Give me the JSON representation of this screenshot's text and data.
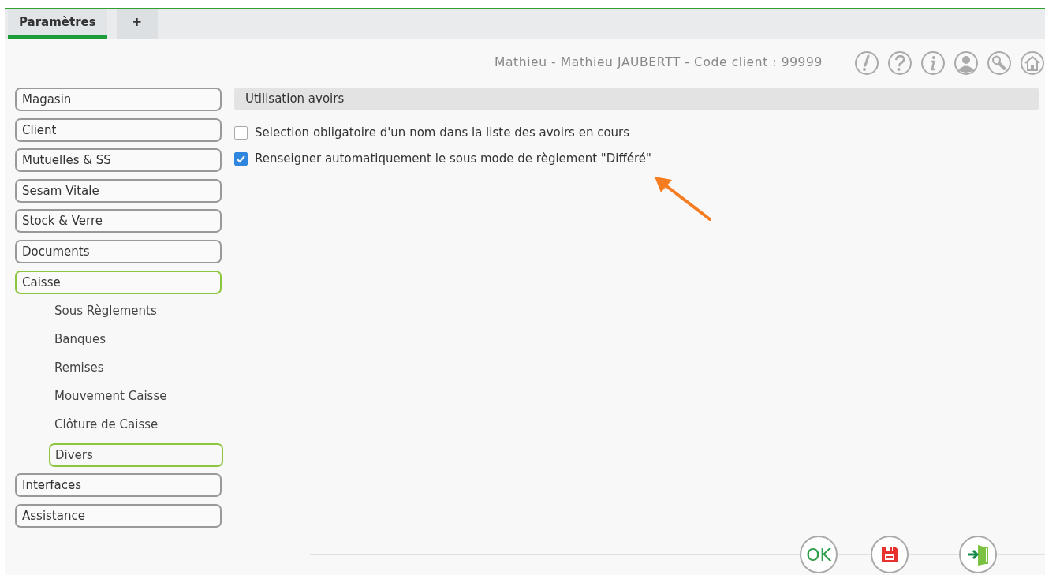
{
  "tabs": [
    {
      "label": "Paramètres",
      "selected": true
    },
    {
      "label": "+",
      "selected": false
    }
  ],
  "user_info": "Mathieu - Mathieu JAUBERTT - Code client : 99999",
  "sidebar": {
    "items": [
      {
        "label": "Magasin",
        "selected": false
      },
      {
        "label": "Client",
        "selected": false
      },
      {
        "label": "Mutuelles & SS",
        "selected": false
      },
      {
        "label": "Sesam Vitale",
        "selected": false
      },
      {
        "label": "Stock & Verre",
        "selected": false
      },
      {
        "label": "Documents",
        "selected": false
      },
      {
        "label": "Caisse",
        "selected": true,
        "children": [
          {
            "label": "Sous Règlements",
            "selected": false
          },
          {
            "label": "Banques",
            "selected": false
          },
          {
            "label": "Remises",
            "selected": false
          },
          {
            "label": "Mouvement Caisse",
            "selected": false
          },
          {
            "label": "Clôture de Caisse",
            "selected": false
          },
          {
            "label": "Divers",
            "selected": true
          }
        ]
      },
      {
        "label": "Interfaces",
        "selected": false
      },
      {
        "label": "Assistance",
        "selected": false
      }
    ]
  },
  "section": {
    "title": "Utilisation avoirs",
    "options": [
      {
        "label": "Selection obligatoire d'un nom dans la liste des avoirs en cours",
        "checked": false
      },
      {
        "label": "Renseigner automatiquement le sous mode de règlement \"Différé\"",
        "checked": true
      }
    ]
  },
  "ok_button": {
    "label": "OK"
  }
}
